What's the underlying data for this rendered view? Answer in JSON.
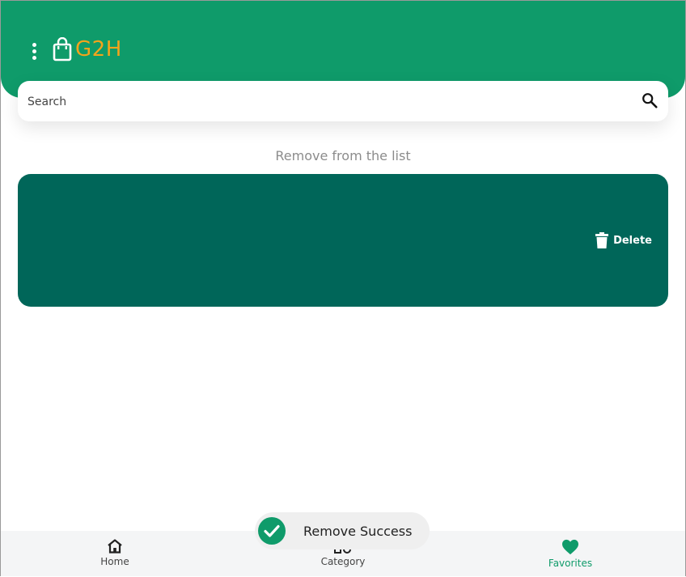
{
  "app": {
    "name": "G2H",
    "brand_color": "#0f9b6a",
    "logo_color": "#f4a41b"
  },
  "header": {
    "menu_icon": "more-vert-icon",
    "logo_icon": "shopping-bag-icon"
  },
  "search": {
    "placeholder": "Search",
    "value": "",
    "icon": "search-icon"
  },
  "list": {
    "title": "Remove from the list",
    "card_color": "#006659",
    "delete_label": "Delete",
    "delete_icon": "trash-icon"
  },
  "bottom_nav": {
    "items": [
      {
        "label": "Home",
        "icon": "home-icon",
        "active": false
      },
      {
        "label": "Category",
        "icon": "category-icon",
        "active": false
      },
      {
        "label": "Favorites",
        "icon": "heart-icon",
        "active": true
      }
    ]
  },
  "toast": {
    "text": "Remove Success",
    "icon": "check-circle-icon"
  }
}
